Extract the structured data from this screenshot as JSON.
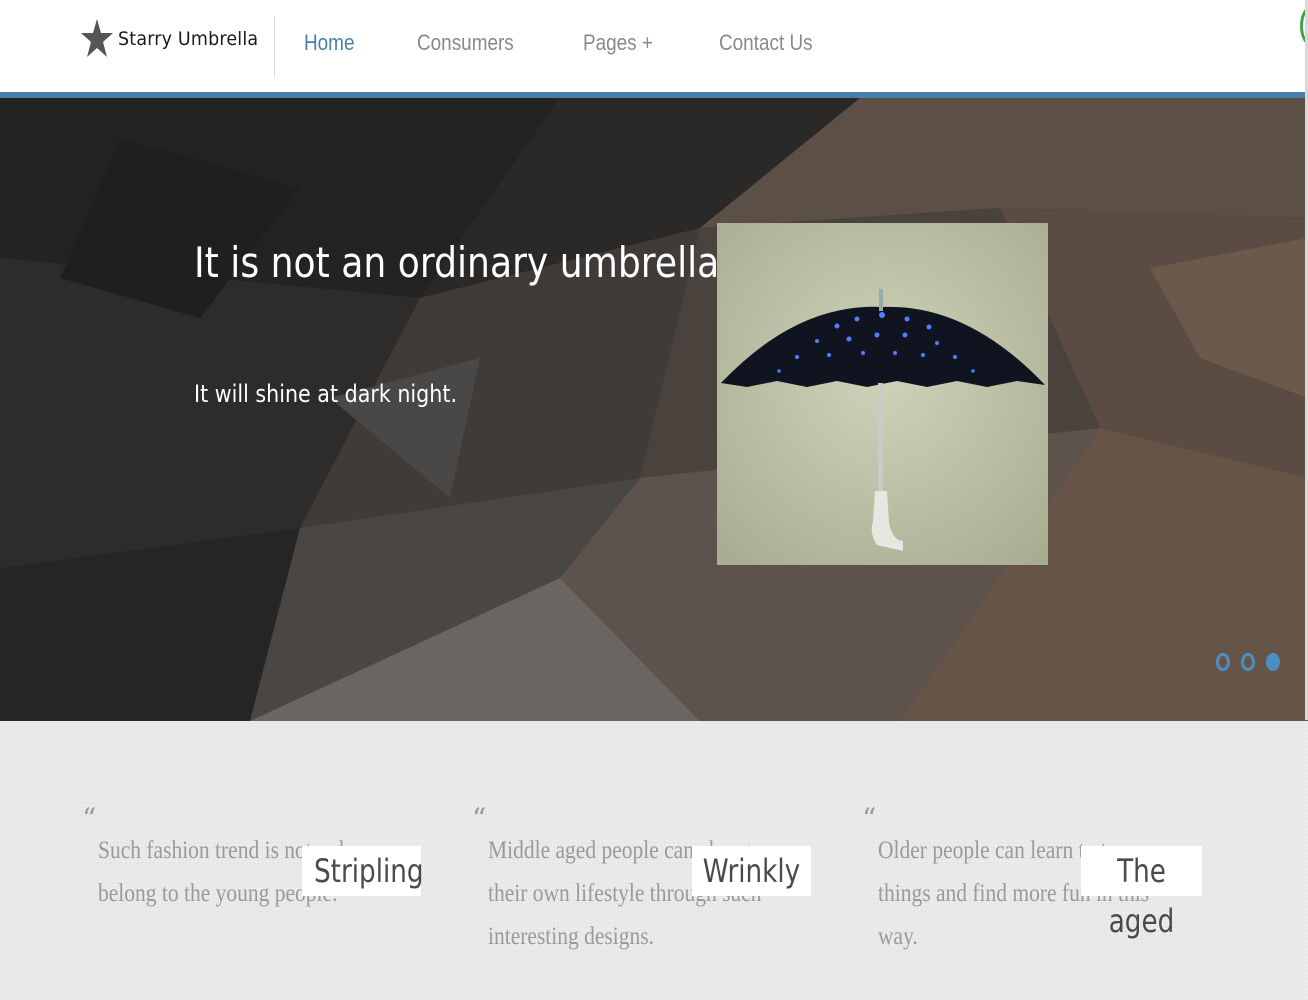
{
  "brand": {
    "name": "Starry Umbrella",
    "icon": "star-icon"
  },
  "nav": {
    "items": [
      {
        "label": "Home",
        "active": true
      },
      {
        "label": "Consumers",
        "active": false
      },
      {
        "label": "Pages +",
        "active": false
      },
      {
        "label": "Contact Us",
        "active": false
      }
    ]
  },
  "colors": {
    "accent": "#4a7fa8",
    "dot": "#4a8fc4",
    "text_muted": "#9a9a9a"
  },
  "hero": {
    "title": "It is not an ordinary umbrella",
    "subtitle": "It will shine at dark night.",
    "image": "starry-umbrella-photo",
    "slides": {
      "count": 3,
      "active_index": 2
    }
  },
  "testimonials": [
    {
      "quote_mark": "“",
      "text": "Such fashion trend is not only belong to the young people.",
      "author": "Stripling"
    },
    {
      "quote_mark": "“",
      "text": "Middle aged people can change their own lifestyle through such interesting designs.",
      "author": "Wrinkly"
    },
    {
      "quote_mark": "“",
      "text": "Older people can learn to try new things and find more fun in this way.",
      "author": "The aged"
    }
  ]
}
